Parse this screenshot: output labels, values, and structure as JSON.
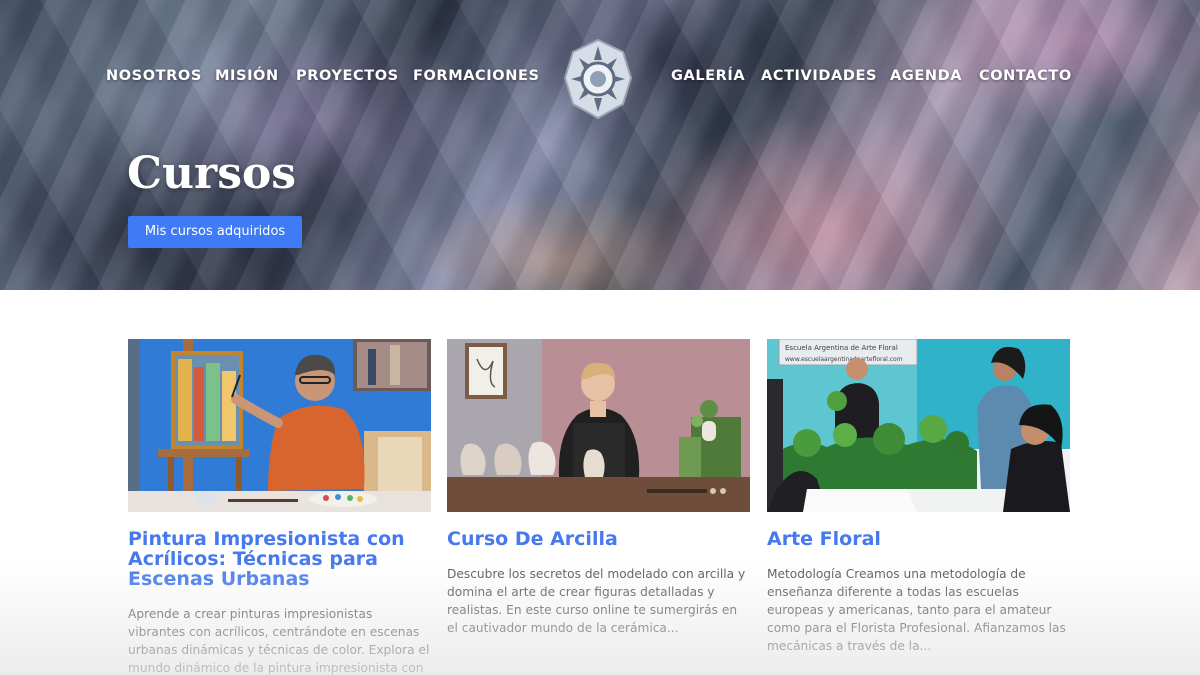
{
  "nav": {
    "left": [
      "NOSOTROS",
      "MISIÓN",
      "PROYECTOS",
      "FORMACIONES"
    ],
    "right": [
      "GALERÍA",
      "ACTIVIDADES",
      "AGENDA",
      "CONTACTO"
    ],
    "logo_icon": "sun-mandala-logo-icon"
  },
  "hero": {
    "title": "Cursos",
    "button_label": "Mis cursos adquiridos"
  },
  "colors": {
    "accent": "#3f7bf4",
    "card_title": "#4779ee",
    "body_text": "#555a60"
  },
  "courses": [
    {
      "title": "Pintura Impresionista con Acrílicos: Técnicas para Escenas Urbanas",
      "description": "Aprende a crear pinturas impresionistas vibrantes con acrílicos, centrándote en escenas urbanas dinámicas y técnicas de color. Explora el mundo dinámico de la pintura impresionista con acrílicos,"
    },
    {
      "title": "Curso De Arcilla",
      "description": "Descubre los secretos del modelado con arcilla y domina el arte de crear figuras detalladas y realistas. En este curso online te sumergirás en el cautivador mundo de la cerámica..."
    },
    {
      "title": "Arte Floral",
      "description": "Metodología Creamos una metodología de enseñanza diferente a todas las escuelas europeas y americanas, tanto para el amateur como para el Florista Profesional. Afianzamos las mecánicas a través de la...",
      "image_sign": [
        "Escuela Argentina de Arte Floral",
        "www.escuelaargentinadeartefloral.com"
      ]
    }
  ]
}
